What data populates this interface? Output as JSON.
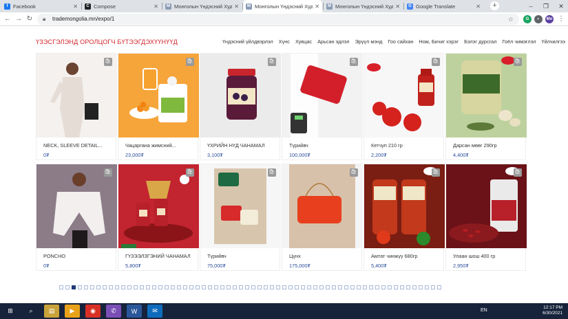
{
  "browser": {
    "tabs": [
      {
        "title": "Facebook",
        "favicon_color": "#1877f2",
        "icon": "f"
      },
      {
        "title": "Compose",
        "favicon_color": "#202124",
        "icon": "C"
      },
      {
        "title": "Монголын Үндэсний Худалда",
        "favicon_color": "#8a9bb5",
        "icon": "M"
      },
      {
        "title": "Монголын Үндэсний Худалда",
        "favicon_color": "#8a9bb5",
        "icon": "M"
      },
      {
        "title": "Монголын Үндэсний Худалда",
        "favicon_color": "#8a9bb5",
        "icon": "M"
      },
      {
        "title": "Google Translate",
        "favicon_color": "#4285f4",
        "icon": "G"
      }
    ],
    "active_tab": 3,
    "url": "trademongolia.mn/expo/1",
    "window_controls": [
      "–",
      "❐",
      "✕"
    ]
  },
  "site": {
    "title": "ҮЗЭСГЭЛЭНД ОРОЛЦОГЧ БҮТЭЭГДЭХҮҮНҮҮД",
    "menu": [
      "Үндэсний үйлдвэрлэл",
      "Хүнс",
      "Хувцас",
      "Арьсан эдлэл",
      "Эрүүл мэнд",
      "Гоо сайхан",
      "Ном, Бичиг хэрэг",
      "Бэлэг дурсгал",
      "Гоёл чимэглэл",
      "Үйлчилгээ"
    ],
    "accent": "#d0232a",
    "price_color": "#2a4d9b"
  },
  "products": [
    {
      "name": "NECK, SLEEVE DETAIL...",
      "price": "0₮",
      "art": "woman-white"
    },
    {
      "name": "Чацаргана жимсний...",
      "price": "23,000₮",
      "art": "seabuckthorn"
    },
    {
      "name": "ҮХРИЙН НҮД ЧАНАМАЛ",
      "price": "3,100₮",
      "art": "jam-jar"
    },
    {
      "name": "Түрийвч",
      "price": "100,000₮",
      "art": "red-wallet"
    },
    {
      "name": " Кетчуп 210 гр",
      "price": "2,200₮",
      "art": "ketchup"
    },
    {
      "name": "Дарсан мөөг 290гр",
      "price": "4,400₮",
      "art": "mushroom"
    },
    {
      "name": "PONCHO",
      "price": "0₮",
      "art": "woman-poncho"
    },
    {
      "name": "ГҮЗЭЭЛЗГЭНИЙ ЧАНАМАЛ",
      "price": "5,800₮",
      "art": "strawberry-jam"
    },
    {
      "name": "Түрийвч",
      "price": "75,000₮",
      "art": "wallets"
    },
    {
      "name": "Цүнх",
      "price": "175,000₮",
      "art": "red-bag"
    },
    {
      "name": "Амтат чинжүү 680гр",
      "price": "5,400₮",
      "art": "pepper-jars"
    },
    {
      "name": "Улаан шош 400 гр",
      "price": "2,950₮",
      "art": "red-beans"
    }
  ],
  "pagination": {
    "current": 3,
    "total": 62
  },
  "taskbar": {
    "apps": [
      "start",
      "search",
      "files",
      "media",
      "chrome",
      "viber",
      "word",
      "mail"
    ],
    "lang": "EN",
    "time": "12:17 PM",
    "date": "6/30/2021"
  }
}
